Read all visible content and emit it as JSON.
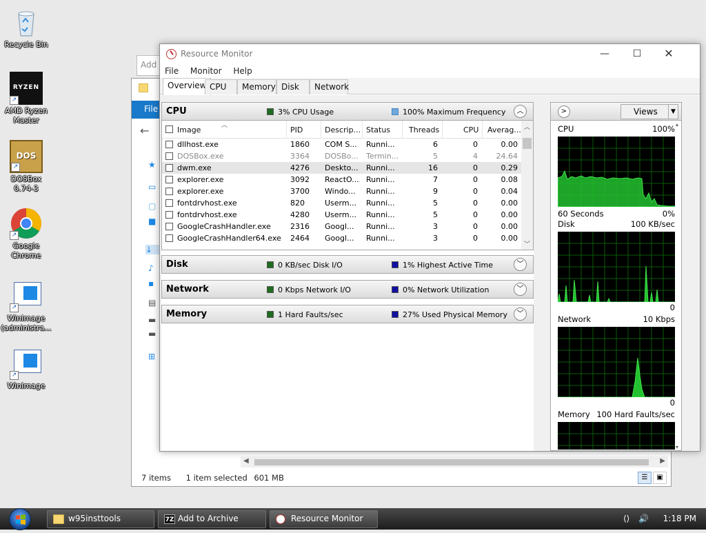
{
  "desktop": {
    "icons": [
      {
        "label": "Recycle Bin"
      },
      {
        "label": "AMD Ryzen Master",
        "logo": "RYZEN"
      },
      {
        "label": "DOSBox 0.74-3",
        "logo": "DOS"
      },
      {
        "label": "Google Chrome"
      },
      {
        "label": "WinImage (administra..."
      },
      {
        "label": "WinImage"
      }
    ]
  },
  "back_windows": {
    "archive_window_text": "Add t",
    "explorer": {
      "ribbon_tab": "File",
      "status_items": "7 items",
      "status_selected": "1 item selected",
      "status_size": "601 MB"
    }
  },
  "resource_monitor": {
    "title": "Resource Monitor",
    "menu": [
      "File",
      "Monitor",
      "Help"
    ],
    "tabs": [
      "Overview",
      "CPU",
      "Memory",
      "Disk",
      "Network"
    ],
    "active_tab": "Overview",
    "sections": {
      "cpu": {
        "name": "CPU",
        "legend1": "3% CPU Usage",
        "legend2": "100% Maximum Frequency",
        "legend1_color": "#1f6b1f",
        "legend2_color": "#6ea8dc"
      },
      "disk": {
        "name": "Disk",
        "legend1": "0 KB/sec Disk I/O",
        "legend2": "1% Highest Active Time",
        "legend1_color": "#1f6b1f",
        "legend2_color": "#1010a0"
      },
      "network": {
        "name": "Network",
        "legend1": "0 Kbps Network I/O",
        "legend2": "0% Network Utilization",
        "legend1_color": "#1f6b1f",
        "legend2_color": "#1010a0"
      },
      "memory": {
        "name": "Memory",
        "legend1": "1 Hard Faults/sec",
        "legend2": "27% Used Physical Memory",
        "legend1_color": "#1f6b1f",
        "legend2_color": "#1010a0"
      }
    },
    "columns": [
      "Image",
      "PID",
      "Descrip...",
      "Status",
      "Threads",
      "CPU",
      "Averag..."
    ],
    "processes": [
      {
        "image": "dllhost.exe",
        "pid": "1860",
        "desc": "COM S...",
        "status": "Runni...",
        "threads": "6",
        "cpu": "0",
        "avg": "0.00"
      },
      {
        "image": "DOSBox.exe",
        "pid": "3364",
        "desc": "DOSBo...",
        "status": "Termin...",
        "threads": "5",
        "cpu": "4",
        "avg": "24.64"
      },
      {
        "image": "dwm.exe",
        "pid": "4276",
        "desc": "Deskto...",
        "status": "Runni...",
        "threads": "16",
        "cpu": "0",
        "avg": "0.29"
      },
      {
        "image": "explorer.exe",
        "pid": "3092",
        "desc": "ReactO...",
        "status": "Runni...",
        "threads": "7",
        "cpu": "0",
        "avg": "0.08"
      },
      {
        "image": "explorer.exe",
        "pid": "3700",
        "desc": "Windo...",
        "status": "Runni...",
        "threads": "9",
        "cpu": "0",
        "avg": "0.04"
      },
      {
        "image": "fontdrvhost.exe",
        "pid": "820",
        "desc": "Userm...",
        "status": "Runni...",
        "threads": "5",
        "cpu": "0",
        "avg": "0.00"
      },
      {
        "image": "fontdrvhost.exe",
        "pid": "4280",
        "desc": "Userm...",
        "status": "Runni...",
        "threads": "5",
        "cpu": "0",
        "avg": "0.00"
      },
      {
        "image": "GoogleCrashHandler.exe",
        "pid": "2316",
        "desc": "Googl...",
        "status": "Runni...",
        "threads": "3",
        "cpu": "0",
        "avg": "0.00"
      },
      {
        "image": "GoogleCrashHandler64.exe",
        "pid": "2464",
        "desc": "Googl...",
        "status": "Runni...",
        "threads": "3",
        "cpu": "0",
        "avg": "0.00"
      }
    ],
    "right_pane": {
      "views_label": "Views",
      "graphs": {
        "cpu": {
          "label": "CPU",
          "max": "100%",
          "bottom_left": "60 Seconds",
          "bottom_right": "0%"
        },
        "disk": {
          "label": "Disk",
          "max": "100 KB/sec",
          "bottom_right": "0"
        },
        "network": {
          "label": "Network",
          "max": "10 Kbps",
          "bottom_right": "0"
        },
        "memory": {
          "label": "Memory",
          "max": "100 Hard Faults/sec"
        }
      }
    }
  },
  "taskbar": {
    "items": [
      "w95insttools",
      "Add to Archive",
      "Resource Monitor"
    ],
    "clock": "1:18 PM"
  }
}
